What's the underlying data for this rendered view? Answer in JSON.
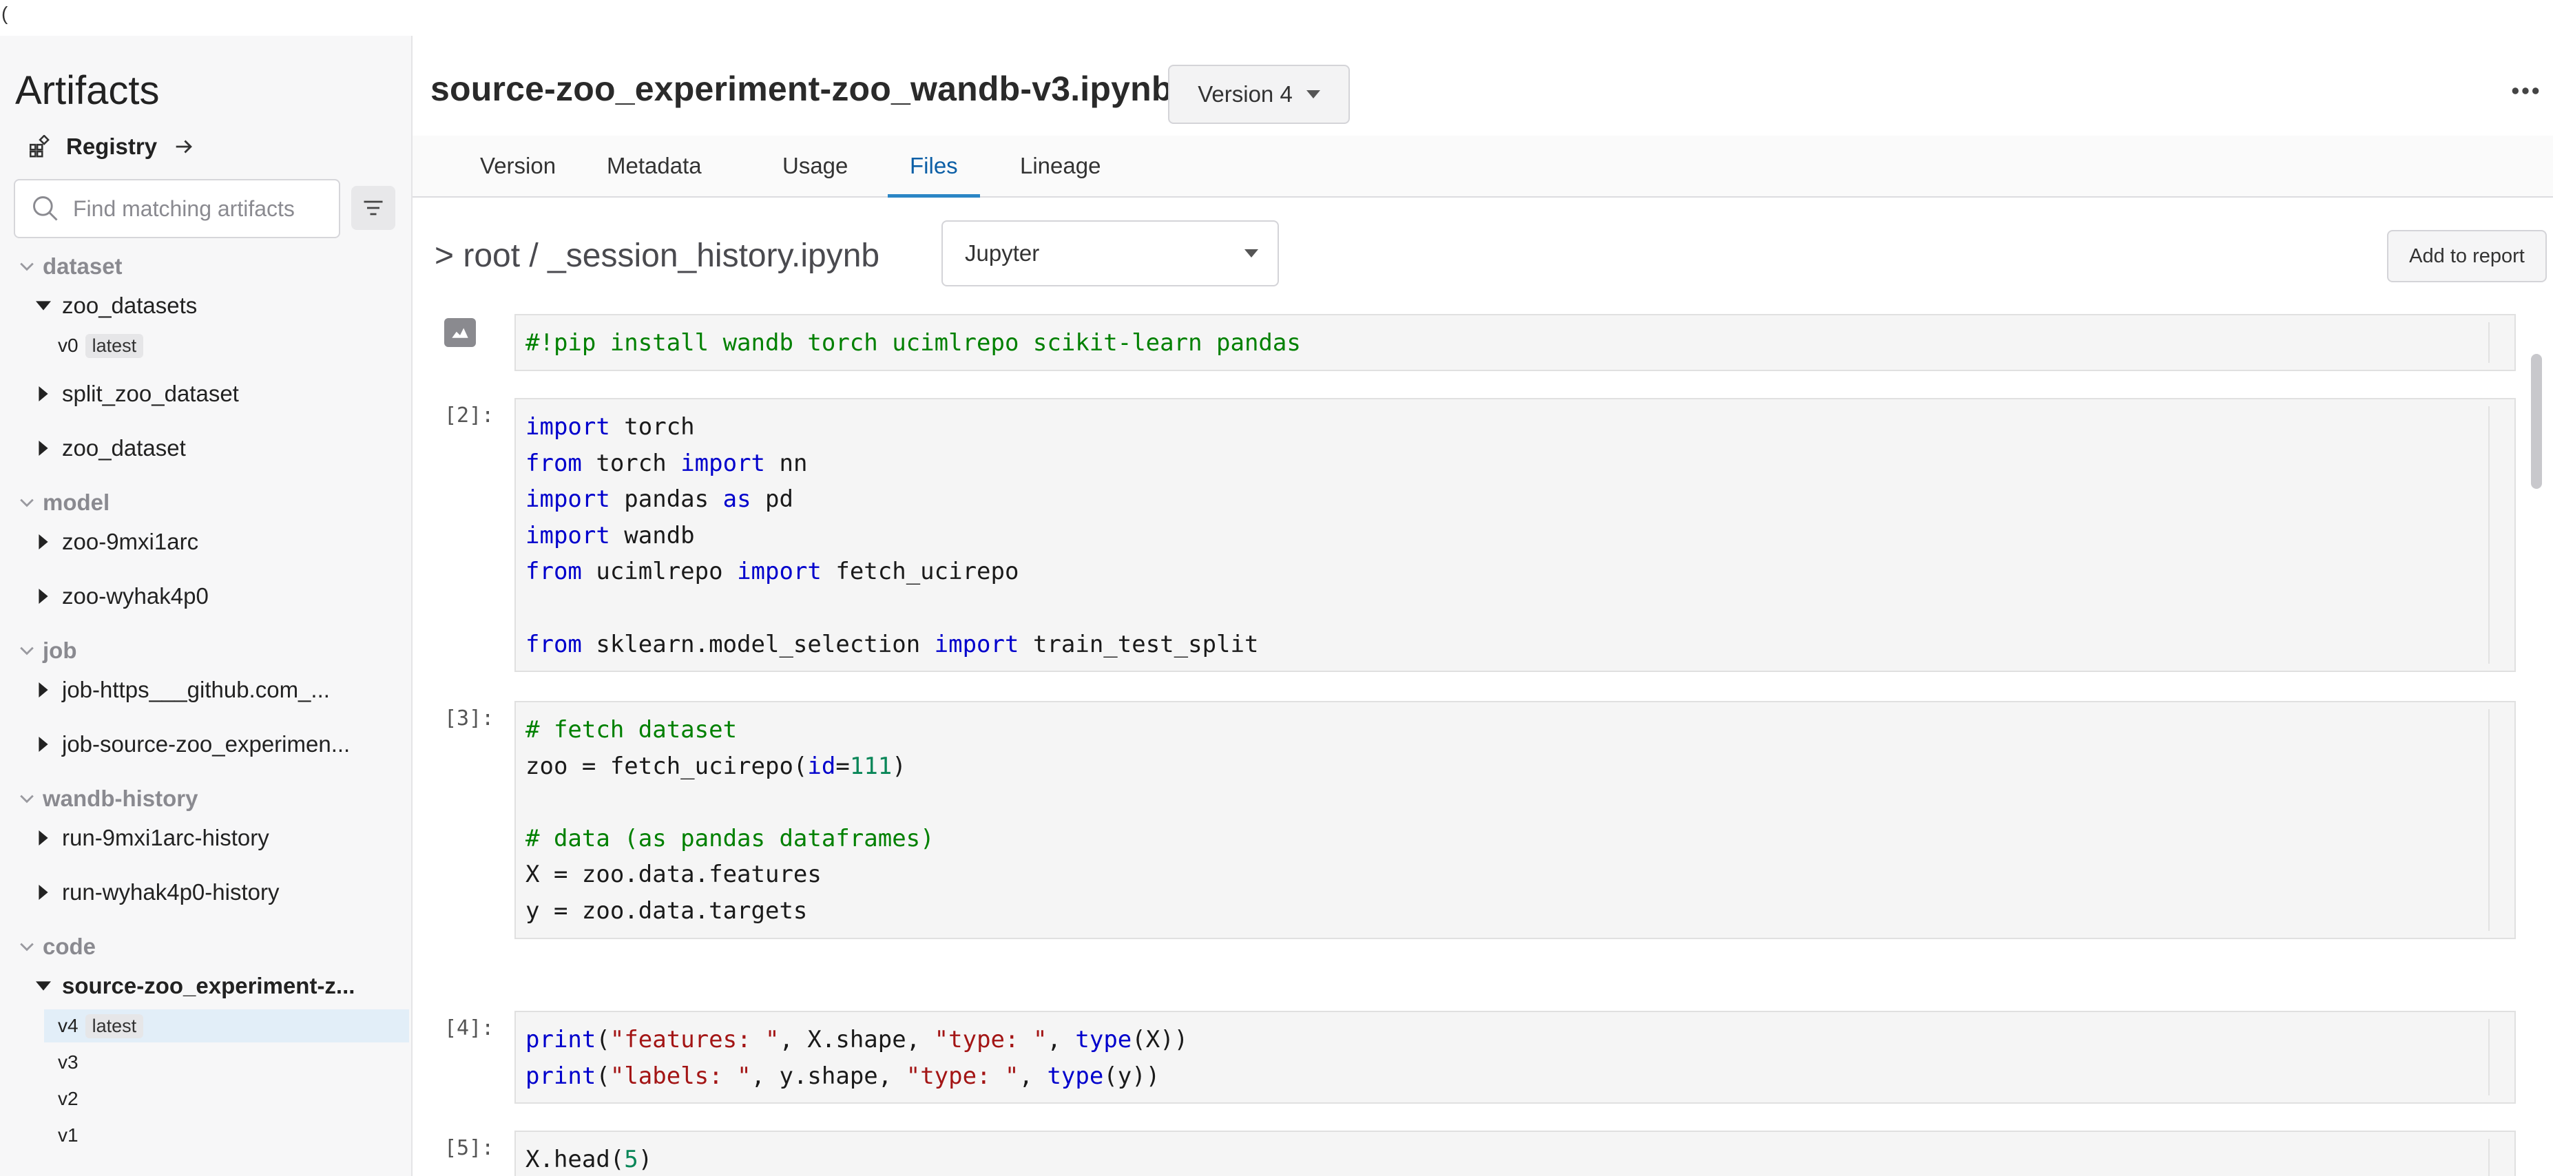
{
  "stray_char": "(",
  "sidebar": {
    "title": "Artifacts",
    "registry_label": "Registry",
    "search_placeholder": "Find matching artifacts",
    "groups": [
      {
        "label": "dataset",
        "items": [
          {
            "label": "zoo_datasets",
            "expanded": true,
            "versions": [
              {
                "v": "v0",
                "tag": "latest"
              }
            ]
          },
          {
            "label": "split_zoo_dataset"
          },
          {
            "label": "zoo_dataset"
          }
        ]
      },
      {
        "label": "model",
        "items": [
          {
            "label": "zoo-9mxi1arc"
          },
          {
            "label": "zoo-wyhak4p0"
          }
        ]
      },
      {
        "label": "job",
        "items": [
          {
            "label": "job-https___github.com_..."
          },
          {
            "label": "job-source-zoo_experimen..."
          }
        ]
      },
      {
        "label": "wandb-history",
        "items": [
          {
            "label": "run-9mxi1arc-history"
          },
          {
            "label": "run-wyhak4p0-history"
          }
        ]
      },
      {
        "label": "code",
        "items": [
          {
            "label": "source-zoo_experiment-z...",
            "expanded": true,
            "bold": true,
            "versions": [
              {
                "v": "v4",
                "tag": "latest",
                "selected": true
              },
              {
                "v": "v3"
              },
              {
                "v": "v2"
              },
              {
                "v": "v1"
              }
            ]
          }
        ]
      }
    ]
  },
  "header": {
    "file_title": "source-zoo_experiment-zoo_wandb-v3.ipynb",
    "version_label": "Version 4"
  },
  "tabs": [
    {
      "label": "Version"
    },
    {
      "label": "Metadata"
    },
    {
      "label": "Usage"
    },
    {
      "label": "Files",
      "active": true
    },
    {
      "label": "Lineage"
    }
  ],
  "file_view": {
    "breadcrumb": "> root / _session_history.ipynb",
    "viewer": "Jupyter",
    "add_to_report": "Add to report"
  },
  "cells": [
    {
      "prompt": "",
      "icon": "chart-icon",
      "lines": [
        [
          [
            "cm",
            "#!pip install wandb torch ucimlrepo scikit-learn pandas"
          ]
        ]
      ]
    },
    {
      "prompt": "[2]:",
      "lines": [
        [
          [
            "kw",
            "import"
          ],
          [
            "",
            " torch"
          ]
        ],
        [
          [
            "kw",
            "from"
          ],
          [
            "",
            " torch "
          ],
          [
            "kw",
            "import"
          ],
          [
            "",
            " nn"
          ]
        ],
        [
          [
            "kw",
            "import"
          ],
          [
            "",
            " pandas "
          ],
          [
            "kw",
            "as"
          ],
          [
            "",
            " pd"
          ]
        ],
        [
          [
            "kw",
            "import"
          ],
          [
            "",
            " wandb"
          ]
        ],
        [
          [
            "kw",
            "from"
          ],
          [
            "",
            " ucimlrepo "
          ],
          [
            "kw",
            "import"
          ],
          [
            "",
            " fetch_ucirepo"
          ]
        ],
        [],
        [
          [
            "kw",
            "from"
          ],
          [
            "",
            " sklearn.model_selection "
          ],
          [
            "kw",
            "import"
          ],
          [
            "",
            " train_test_split"
          ]
        ]
      ]
    },
    {
      "prompt": "[3]:",
      "lines": [
        [
          [
            "cm",
            "# fetch dataset"
          ]
        ],
        [
          [
            "",
            "zoo = fetch_ucirepo("
          ],
          [
            "kw",
            "id"
          ],
          [
            "",
            "="
          ],
          [
            "num",
            "111"
          ],
          [
            "",
            ")"
          ]
        ],
        [],
        [
          [
            "cm",
            "# data (as pandas dataframes)"
          ]
        ],
        [
          [
            "",
            "X = zoo.data.features"
          ]
        ],
        [
          [
            "",
            "y = zoo.data.targets"
          ]
        ]
      ]
    },
    {
      "prompt": "[4]:",
      "lines": [
        [
          [
            "kw",
            "print"
          ],
          [
            "",
            "("
          ],
          [
            "str",
            "\"features: \""
          ],
          [
            "",
            ", X.shape, "
          ],
          [
            "str",
            "\"type: \""
          ],
          [
            "",
            ", "
          ],
          [
            "kw",
            "type"
          ],
          [
            "",
            "(X))"
          ]
        ],
        [
          [
            "kw",
            "print"
          ],
          [
            "",
            "("
          ],
          [
            "str",
            "\"labels: \""
          ],
          [
            "",
            ", y.shape, "
          ],
          [
            "str",
            "\"type: \""
          ],
          [
            "",
            ", "
          ],
          [
            "kw",
            "type"
          ],
          [
            "",
            "(y))"
          ]
        ]
      ]
    },
    {
      "prompt": "[5]:",
      "lines": [
        [
          [
            "",
            "X.head("
          ],
          [
            "num",
            "5"
          ],
          [
            "",
            ")"
          ]
        ]
      ]
    }
  ]
}
